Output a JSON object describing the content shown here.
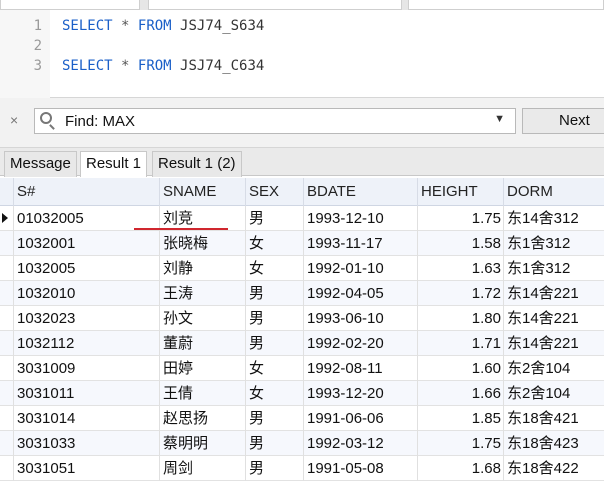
{
  "editor": {
    "lines": [
      {
        "num": "1",
        "kw1": "SELECT",
        "op": "*",
        "kw2": "FROM",
        "table": "JSJ74_S634"
      },
      {
        "num": "2"
      },
      {
        "num": "3",
        "kw1": "SELECT",
        "op": "*",
        "kw2": "FROM",
        "table": "JSJ74_C634"
      }
    ]
  },
  "find": {
    "close": "×",
    "value": "Find: MAX",
    "dropdown": "▼",
    "next_label": "Next"
  },
  "result_tabs": [
    "Message",
    "Result 1",
    "Result 1 (2)"
  ],
  "table": {
    "columns": [
      "S#",
      "SNAME",
      "SEX",
      "BDATE",
      "HEIGHT",
      "DORM"
    ],
    "rows": [
      [
        "01032005",
        "刘竞",
        "男",
        "1993-12-10",
        "1.75",
        "东14舍312"
      ],
      [
        "1032001",
        "张晓梅",
        "女",
        "1993-11-17",
        "1.58",
        "东1舍312"
      ],
      [
        "1032005",
        "刘静",
        "女",
        "1992-01-10",
        "1.63",
        "东1舍312"
      ],
      [
        "1032010",
        "王涛",
        "男",
        "1992-04-05",
        "1.72",
        "东14舍221"
      ],
      [
        "1032023",
        "孙文",
        "男",
        "1993-06-10",
        "1.80",
        "东14舍221"
      ],
      [
        "1032112",
        "董蔚",
        "男",
        "1992-02-20",
        "1.71",
        "东14舍221"
      ],
      [
        "3031009",
        "田婷",
        "女",
        "1992-08-11",
        "1.60",
        "东2舍104"
      ],
      [
        "3031011",
        "王倩",
        "女",
        "1993-12-20",
        "1.66",
        "东2舍104"
      ],
      [
        "3031014",
        "赵思扬",
        "男",
        "1991-06-06",
        "1.85",
        "东18舍421"
      ],
      [
        "3031033",
        "蔡明明",
        "男",
        "1992-03-12",
        "1.75",
        "东18舍423"
      ],
      [
        "3031051",
        "周剑",
        "男",
        "1991-05-08",
        "1.68",
        "东18舍422"
      ]
    ]
  },
  "colors": {
    "keyword": "#1a5fc8",
    "annotation": "#d0262e"
  }
}
